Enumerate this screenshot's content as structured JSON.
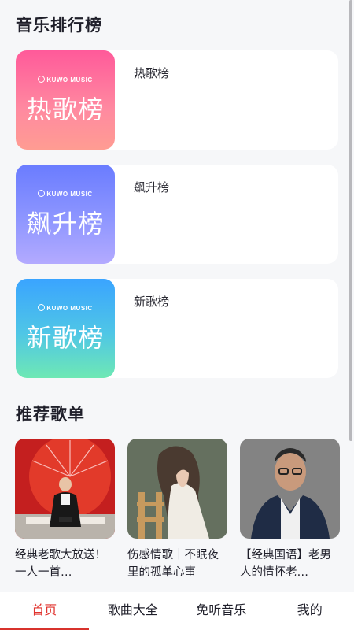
{
  "sections": {
    "rankings_title": "音乐排行榜",
    "playlists_title": "推荐歌单"
  },
  "rankings": [
    {
      "brand": "KUWO MUSIC",
      "cover_title": "热歌榜",
      "name": "热歌榜"
    },
    {
      "brand": "KUWO MUSIC",
      "cover_title": "飙升榜",
      "name": "飙升榜"
    },
    {
      "brand": "KUWO MUSIC",
      "cover_title": "新歌榜",
      "name": "新歌榜"
    }
  ],
  "playlists": [
    {
      "title": "经典老歌大放送！一人一首…",
      "cover": "singer-on-stage-image"
    },
    {
      "title": "伤感情歌｜不眠夜里的孤单心事",
      "cover": "girl-illustration-image"
    },
    {
      "title": "【经典国语】老男人的情怀老…",
      "cover": "man-portrait-image"
    }
  ],
  "tabbar": {
    "tabs": [
      {
        "label": "首页",
        "active": true
      },
      {
        "label": "歌曲大全",
        "active": false
      },
      {
        "label": "免听音乐",
        "active": false
      },
      {
        "label": "我的",
        "active": false
      }
    ]
  },
  "colors": {
    "accent": "#e0332e",
    "background": "#f6f7f9",
    "card": "#ffffff"
  }
}
